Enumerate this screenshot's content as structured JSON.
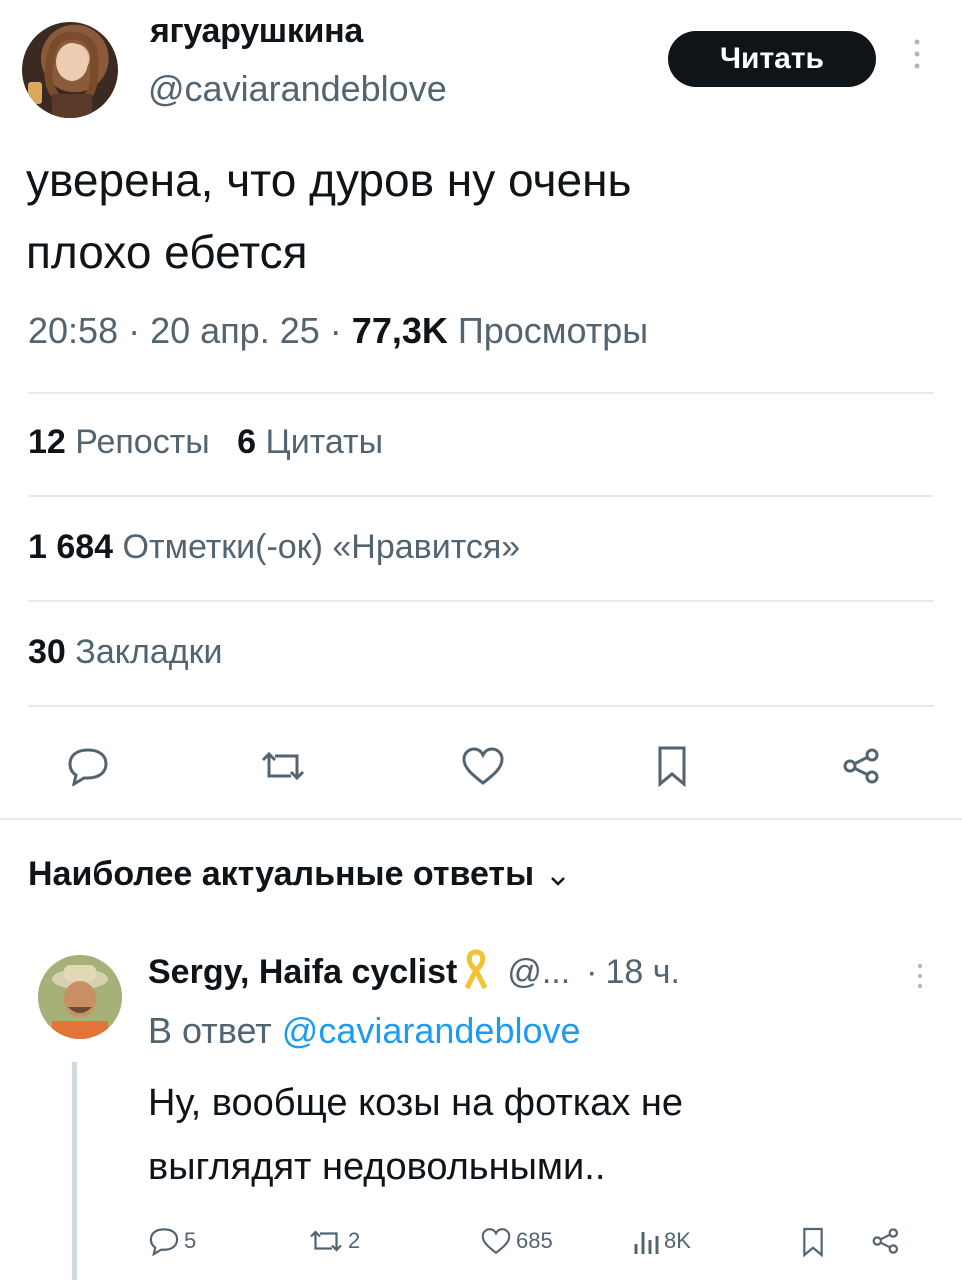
{
  "tweet": {
    "author_name": "ягуарушкина",
    "author_handle": "@caviarandeblove",
    "follow_label": "Читать",
    "text_line1": "уверена, что дуров ну очень",
    "text_line2": "плохо ебется",
    "time": "20:58",
    "sep1": "·",
    "date": "20 апр. 25",
    "sep2": "·",
    "views_count": "77,3K",
    "views_label": "Просмотры"
  },
  "stats": {
    "reposts_count": "12",
    "reposts_label": "Репосты",
    "quotes_count": "6",
    "quotes_label": "Цитаты",
    "likes_count": "1 684",
    "likes_label": "Отметки(-ок) «Нравится»",
    "bookmarks_count": "30",
    "bookmarks_label": "Закладки"
  },
  "replies_header": {
    "label": "Наиболее актуальные ответы",
    "chevron": "chevron-down-icon"
  },
  "reply": {
    "author_name": "Sergy, Haifa cyclist",
    "handle_trunc": "@...",
    "sep": "·",
    "age": "18 ч.",
    "reply_to_prefix": "В ответ",
    "reply_to_handle": "@caviarandeblove",
    "text_line1": "Ну, вообще козы на фотках не",
    "text_line2": "выглядят недовольными..",
    "replies_count": "5",
    "reposts_count": "2",
    "likes_count": "685",
    "views_count": "8K"
  },
  "colors": {
    "text": "#0f1419",
    "muted": "#536471",
    "divider": "#e7e9ea",
    "follow_bg": "#0f1419",
    "ribbon": "#f2c230"
  },
  "icons": [
    "more-icon",
    "reply-icon",
    "repost-icon",
    "like-icon",
    "bookmark-icon",
    "share-icon",
    "views-icon",
    "ribbon-icon"
  ]
}
